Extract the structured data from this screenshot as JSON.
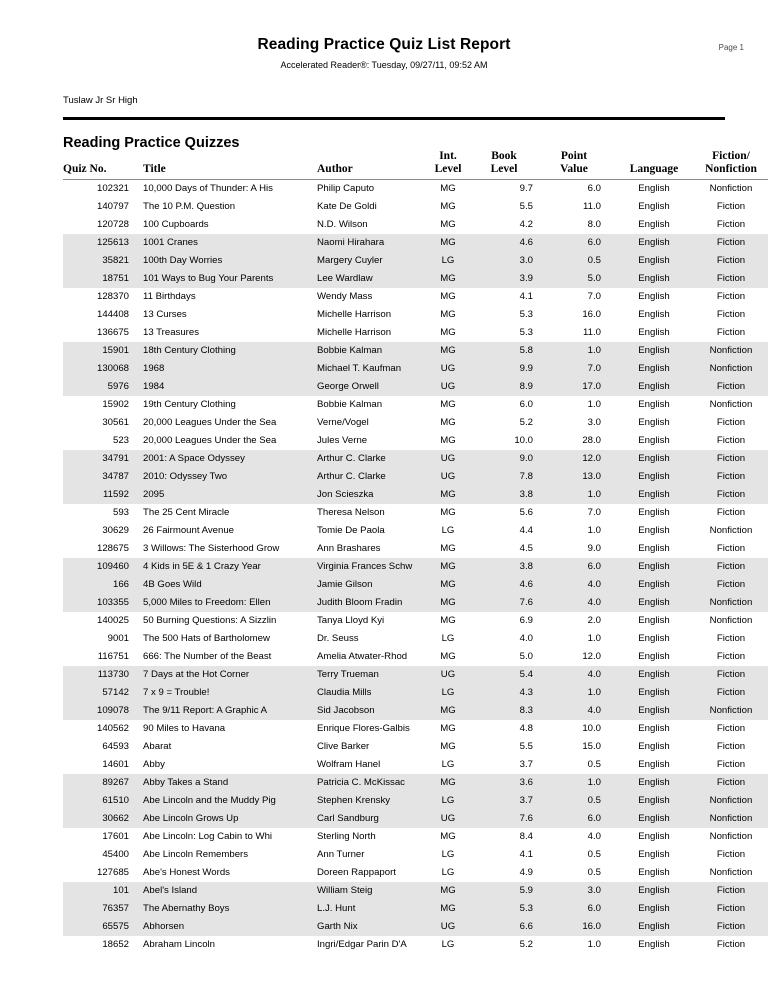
{
  "header": {
    "title": "Reading Practice Quiz List Report",
    "subtitle": "Accelerated Reader®:  Tuesday, 09/27/11, 09:52 AM",
    "page_label": "Page 1",
    "school": "Tuslaw Jr Sr High"
  },
  "section": {
    "title": "Reading Practice Quizzes"
  },
  "table": {
    "columns": [
      {
        "key": "quiz_no",
        "label": "Quiz No."
      },
      {
        "key": "title",
        "label": "Title"
      },
      {
        "key": "author",
        "label": "Author"
      },
      {
        "key": "int_level",
        "label": "Int.\nLevel"
      },
      {
        "key": "book_level",
        "label": "Book\nLevel"
      },
      {
        "key": "point_value",
        "label": "Point\nValue"
      },
      {
        "key": "language",
        "label": "Language"
      },
      {
        "key": "fiction",
        "label": "Fiction/\nNonfiction"
      }
    ],
    "rows": [
      {
        "quiz_no": "102321",
        "title": "10,000 Days of Thunder: A His",
        "author": "Philip  Caputo",
        "int_level": "MG",
        "book_level": "9.7",
        "point_value": "6.0",
        "language": "English",
        "fiction": "Nonfiction"
      },
      {
        "quiz_no": "140797",
        "title": "The 10 P.M. Question",
        "author": "Kate De Goldi",
        "int_level": "MG",
        "book_level": "5.5",
        "point_value": "11.0",
        "language": "English",
        "fiction": "Fiction"
      },
      {
        "quiz_no": "120728",
        "title": "100 Cupboards",
        "author": "N.D. Wilson",
        "int_level": "MG",
        "book_level": "4.2",
        "point_value": "8.0",
        "language": "English",
        "fiction": "Fiction"
      },
      {
        "quiz_no": "125613",
        "title": "1001 Cranes",
        "author": "Naomi Hirahara",
        "int_level": "MG",
        "book_level": "4.6",
        "point_value": "6.0",
        "language": "English",
        "fiction": "Fiction"
      },
      {
        "quiz_no": "35821",
        "title": "100th Day Worries",
        "author": "Margery Cuyler",
        "int_level": "LG",
        "book_level": "3.0",
        "point_value": "0.5",
        "language": "English",
        "fiction": "Fiction"
      },
      {
        "quiz_no": "18751",
        "title": "101 Ways to Bug Your Parents",
        "author": "Lee Wardlaw",
        "int_level": "MG",
        "book_level": "3.9",
        "point_value": "5.0",
        "language": "English",
        "fiction": "Fiction"
      },
      {
        "quiz_no": "128370",
        "title": "11 Birthdays",
        "author": "Wendy  Mass",
        "int_level": "MG",
        "book_level": "4.1",
        "point_value": "7.0",
        "language": "English",
        "fiction": "Fiction"
      },
      {
        "quiz_no": "144408",
        "title": "13 Curses",
        "author": "Michelle Harrison",
        "int_level": "MG",
        "book_level": "5.3",
        "point_value": "16.0",
        "language": "English",
        "fiction": "Fiction"
      },
      {
        "quiz_no": "136675",
        "title": "13 Treasures",
        "author": "Michelle Harrison",
        "int_level": "MG",
        "book_level": "5.3",
        "point_value": "11.0",
        "language": "English",
        "fiction": "Fiction"
      },
      {
        "quiz_no": "15901",
        "title": "18th Century Clothing",
        "author": "Bobbie  Kalman",
        "int_level": "MG",
        "book_level": "5.8",
        "point_value": "1.0",
        "language": "English",
        "fiction": "Nonfiction"
      },
      {
        "quiz_no": "130068",
        "title": "1968",
        "author": "Michael T. Kaufman",
        "int_level": "UG",
        "book_level": "9.9",
        "point_value": "7.0",
        "language": "English",
        "fiction": "Nonfiction"
      },
      {
        "quiz_no": "5976",
        "title": "1984",
        "author": "George Orwell",
        "int_level": "UG",
        "book_level": "8.9",
        "point_value": "17.0",
        "language": "English",
        "fiction": "Fiction"
      },
      {
        "quiz_no": "15902",
        "title": "19th Century Clothing",
        "author": "Bobbie  Kalman",
        "int_level": "MG",
        "book_level": "6.0",
        "point_value": "1.0",
        "language": "English",
        "fiction": "Nonfiction"
      },
      {
        "quiz_no": "30561",
        "title": "20,000 Leagues Under the Sea",
        "author": "Verne/Vogel",
        "int_level": "MG",
        "book_level": "5.2",
        "point_value": "3.0",
        "language": "English",
        "fiction": "Fiction"
      },
      {
        "quiz_no": "523",
        "title": "20,000 Leagues Under the Sea",
        "author": "Jules Verne",
        "int_level": "MG",
        "book_level": "10.0",
        "point_value": "28.0",
        "language": "English",
        "fiction": "Fiction"
      },
      {
        "quiz_no": "34791",
        "title": "2001: A Space Odyssey",
        "author": "Arthur C. Clarke",
        "int_level": "UG",
        "book_level": "9.0",
        "point_value": "12.0",
        "language": "English",
        "fiction": "Fiction"
      },
      {
        "quiz_no": "34787",
        "title": "2010: Odyssey Two",
        "author": "Arthur C. Clarke",
        "int_level": "UG",
        "book_level": "7.8",
        "point_value": "13.0",
        "language": "English",
        "fiction": "Fiction"
      },
      {
        "quiz_no": "11592",
        "title": "2095",
        "author": "Jon Scieszka",
        "int_level": "MG",
        "book_level": "3.8",
        "point_value": "1.0",
        "language": "English",
        "fiction": "Fiction"
      },
      {
        "quiz_no": "593",
        "title": "The 25 Cent Miracle",
        "author": "Theresa Nelson",
        "int_level": "MG",
        "book_level": "5.6",
        "point_value": "7.0",
        "language": "English",
        "fiction": "Fiction"
      },
      {
        "quiz_no": "30629",
        "title": "26 Fairmount Avenue",
        "author": "Tomie De Paola",
        "int_level": "LG",
        "book_level": "4.4",
        "point_value": "1.0",
        "language": "English",
        "fiction": "Nonfiction"
      },
      {
        "quiz_no": "128675",
        "title": "3 Willows: The Sisterhood Grow",
        "author": "Ann Brashares",
        "int_level": "MG",
        "book_level": "4.5",
        "point_value": "9.0",
        "language": "English",
        "fiction": "Fiction"
      },
      {
        "quiz_no": "109460",
        "title": "4 Kids in 5E & 1 Crazy Year",
        "author": "Virginia Frances Schw",
        "int_level": "MG",
        "book_level": "3.8",
        "point_value": "6.0",
        "language": "English",
        "fiction": "Fiction"
      },
      {
        "quiz_no": "166",
        "title": "4B Goes Wild",
        "author": "Jamie  Gilson",
        "int_level": "MG",
        "book_level": "4.6",
        "point_value": "4.0",
        "language": "English",
        "fiction": "Fiction"
      },
      {
        "quiz_no": "103355",
        "title": "5,000 Miles to Freedom: Ellen",
        "author": "Judith Bloom Fradin",
        "int_level": "MG",
        "book_level": "7.6",
        "point_value": "4.0",
        "language": "English",
        "fiction": "Nonfiction"
      },
      {
        "quiz_no": "140025",
        "title": "50 Burning Questions: A Sizzlin",
        "author": "Tanya Lloyd Kyi",
        "int_level": "MG",
        "book_level": "6.9",
        "point_value": "2.0",
        "language": "English",
        "fiction": "Nonfiction"
      },
      {
        "quiz_no": "9001",
        "title": "The 500 Hats of Bartholomew",
        "author": "Dr. Seuss",
        "int_level": "LG",
        "book_level": "4.0",
        "point_value": "1.0",
        "language": "English",
        "fiction": "Fiction"
      },
      {
        "quiz_no": "116751",
        "title": "666: The Number of the Beast",
        "author": "Amelia  Atwater-Rhod",
        "int_level": "MG",
        "book_level": "5.0",
        "point_value": "12.0",
        "language": "English",
        "fiction": "Fiction"
      },
      {
        "quiz_no": "113730",
        "title": "7 Days at the Hot Corner",
        "author": "Terry Trueman",
        "int_level": "UG",
        "book_level": "5.4",
        "point_value": "4.0",
        "language": "English",
        "fiction": "Fiction"
      },
      {
        "quiz_no": "57142",
        "title": "7 x 9 = Trouble!",
        "author": "Claudia Mills",
        "int_level": "LG",
        "book_level": "4.3",
        "point_value": "1.0",
        "language": "English",
        "fiction": "Fiction"
      },
      {
        "quiz_no": "109078",
        "title": "The 9/11 Report: A Graphic A",
        "author": "Sid Jacobson",
        "int_level": "MG",
        "book_level": "8.3",
        "point_value": "4.0",
        "language": "English",
        "fiction": "Nonfiction"
      },
      {
        "quiz_no": "140562",
        "title": "90 Miles to Havana",
        "author": "Enrique Flores-Galbis",
        "int_level": "MG",
        "book_level": "4.8",
        "point_value": "10.0",
        "language": "English",
        "fiction": "Fiction"
      },
      {
        "quiz_no": "64593",
        "title": "Abarat",
        "author": "Clive Barker",
        "int_level": "MG",
        "book_level": "5.5",
        "point_value": "15.0",
        "language": "English",
        "fiction": "Fiction"
      },
      {
        "quiz_no": "14601",
        "title": "Abby",
        "author": "Wolfram Hanel",
        "int_level": "LG",
        "book_level": "3.7",
        "point_value": "0.5",
        "language": "English",
        "fiction": "Fiction"
      },
      {
        "quiz_no": "89267",
        "title": "Abby Takes a Stand",
        "author": "Patricia C. McKissac",
        "int_level": "MG",
        "book_level": "3.6",
        "point_value": "1.0",
        "language": "English",
        "fiction": "Fiction"
      },
      {
        "quiz_no": "61510",
        "title": "Abe Lincoln and the Muddy Pig",
        "author": "Stephen Krensky",
        "int_level": "LG",
        "book_level": "3.7",
        "point_value": "0.5",
        "language": "English",
        "fiction": "Nonfiction"
      },
      {
        "quiz_no": "30662",
        "title": "Abe Lincoln Grows Up",
        "author": "Carl Sandburg",
        "int_level": "UG",
        "book_level": "7.6",
        "point_value": "6.0",
        "language": "English",
        "fiction": "Nonfiction"
      },
      {
        "quiz_no": "17601",
        "title": "Abe Lincoln: Log Cabin to Whi",
        "author": "Sterling North",
        "int_level": "MG",
        "book_level": "8.4",
        "point_value": "4.0",
        "language": "English",
        "fiction": "Nonfiction"
      },
      {
        "quiz_no": "45400",
        "title": "Abe Lincoln Remembers",
        "author": "Ann Turner",
        "int_level": "LG",
        "book_level": "4.1",
        "point_value": "0.5",
        "language": "English",
        "fiction": "Fiction"
      },
      {
        "quiz_no": "127685",
        "title": "Abe's Honest Words",
        "author": "Doreen Rappaport",
        "int_level": "LG",
        "book_level": "4.9",
        "point_value": "0.5",
        "language": "English",
        "fiction": "Nonfiction"
      },
      {
        "quiz_no": "101",
        "title": "Abel's Island",
        "author": "William Steig",
        "int_level": "MG",
        "book_level": "5.9",
        "point_value": "3.0",
        "language": "English",
        "fiction": "Fiction"
      },
      {
        "quiz_no": "76357",
        "title": "The Abernathy Boys",
        "author": "L.J. Hunt",
        "int_level": "MG",
        "book_level": "5.3",
        "point_value": "6.0",
        "language": "English",
        "fiction": "Fiction"
      },
      {
        "quiz_no": "65575",
        "title": "Abhorsen",
        "author": "Garth Nix",
        "int_level": "UG",
        "book_level": "6.6",
        "point_value": "16.0",
        "language": "English",
        "fiction": "Fiction"
      },
      {
        "quiz_no": "18652",
        "title": "Abraham Lincoln",
        "author": "Ingri/Edgar Parin D'A",
        "int_level": "LG",
        "book_level": "5.2",
        "point_value": "1.0",
        "language": "English",
        "fiction": "Fiction"
      }
    ],
    "shading": {
      "group_size": 3,
      "shaded_color": "#e4e4e4",
      "starts_shaded_at_row_index": 3
    }
  }
}
